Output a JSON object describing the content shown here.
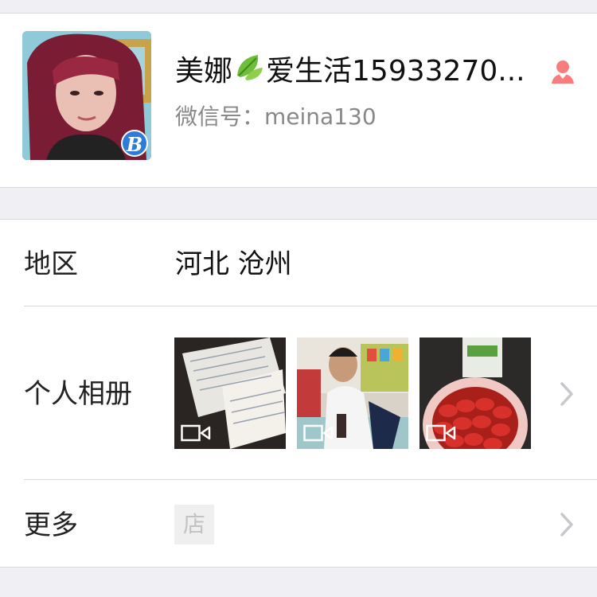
{
  "profile": {
    "name_part1": "美娜",
    "name_part2": "爱生活15933270...",
    "wechat_id": "微信号：meina130",
    "badge_letter": "B",
    "gender": "female",
    "gender_color": "#fa7d7d"
  },
  "details": {
    "region_label": "地区",
    "region_value": "河北 沧州",
    "album_label": "个人相册",
    "more_label": "更多",
    "shop_icon_text": "店"
  },
  "icons": {
    "leaf": "leaf-icon",
    "female": "female-icon",
    "video": "video-camera-icon",
    "chevron": "chevron-right-icon"
  }
}
